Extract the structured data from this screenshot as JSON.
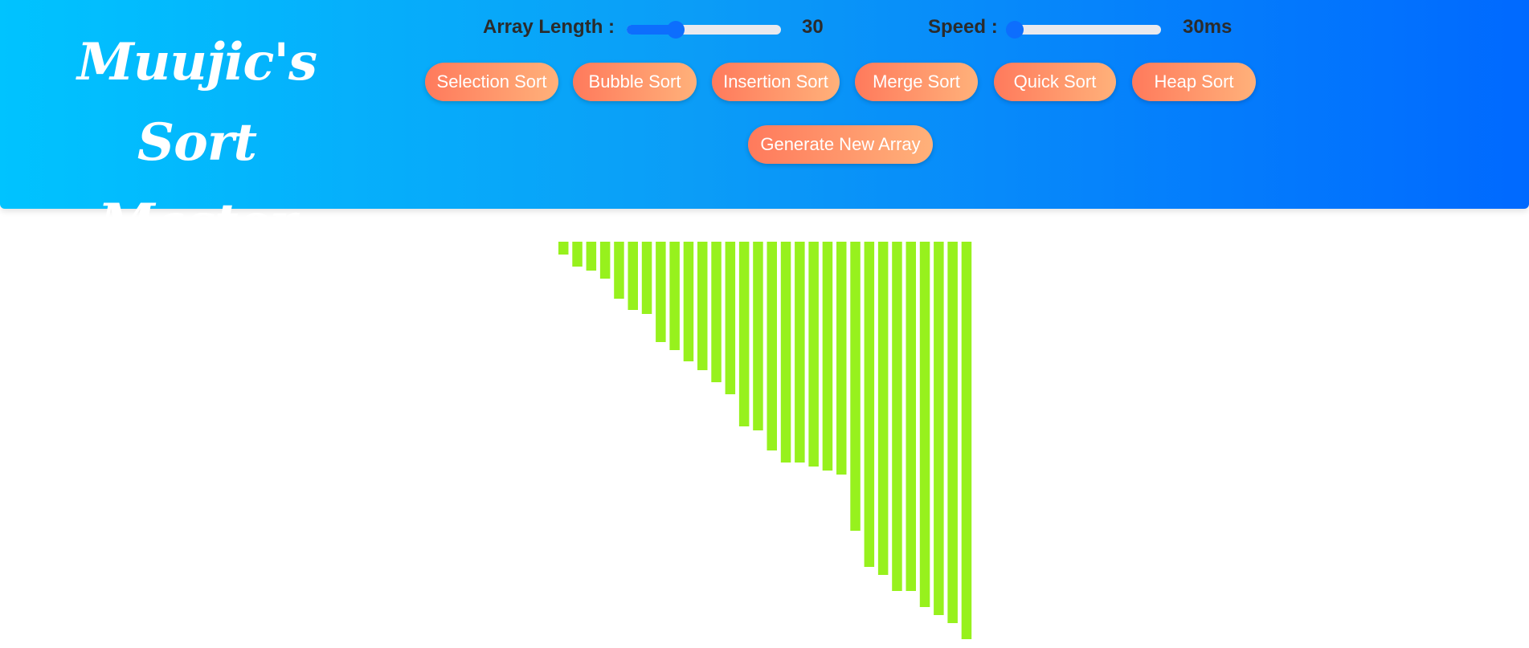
{
  "header": {
    "logo_line1": "Muujic's Sort",
    "logo_line2": "Master"
  },
  "controls": {
    "array_length": {
      "label": "Array Length :",
      "value_text": "30",
      "slider_fraction": 0.32
    },
    "speed": {
      "label": "Speed :",
      "value_text": "30ms",
      "slider_fraction": 0.04
    }
  },
  "buttons": {
    "selection_sort": "Selection Sort",
    "bubble_sort": "Bubble Sort",
    "insertion_sort": "Insertion Sort",
    "merge_sort": "Merge Sort",
    "quick_sort": "Quick Sort",
    "heap_sort": "Heap Sort",
    "generate_new_array": "Generate New Array"
  },
  "colors": {
    "bar": "#97f11d",
    "slider_accent": "#0d6efd",
    "button_start": "#ff7a5c",
    "button_end": "#ffb17a"
  },
  "chart_data": {
    "type": "bar",
    "values": [
      16,
      31,
      36,
      46,
      71,
      85,
      90,
      125,
      135,
      149,
      160,
      175,
      190,
      230,
      235,
      260,
      275,
      275,
      280,
      285,
      290,
      360,
      405,
      415,
      435,
      435,
      455,
      465,
      475,
      495
    ],
    "ylim": [
      0,
      500
    ]
  }
}
